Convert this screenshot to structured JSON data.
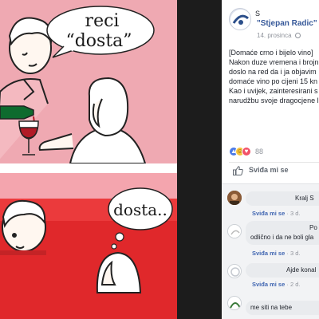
{
  "post": {
    "author_prefix": "S",
    "page_name": "\"Stjepan Radic\" - \"",
    "date": "14. prosinca",
    "body_lines": [
      "[Domaće crno i bijelo vino]",
      "Nakon duze vremena i brojn",
      "doslo na red da i ja objavim",
      "domaće vino po cijeni 15 kn",
      "Kao i uvijek, zainteresirani s",
      "narudžbu svoje dragocjene l"
    ],
    "reaction_count": "88",
    "like_action": "Sviđa mi se"
  },
  "comic": {
    "top_bubble_line1": "reci",
    "top_bubble_line2": "“dosta”",
    "bottom_bubble": "dosta.."
  },
  "comments": [
    {
      "text": "Kralj S",
      "like": "Sviđa mi se",
      "time": "3 d."
    },
    {
      "text_line1": "Po",
      "text_line2": "odlično i da ne boli gla",
      "like": "Sviđa mi se",
      "time": "3 d."
    },
    {
      "text": "Ajde konal",
      "like": "Sviđa mi se",
      "time": "2 d."
    },
    {
      "text": "me siti na tebe"
    }
  ],
  "colors": {
    "comic_pink": "#efa9b2",
    "comic_red": "#eb3a3c",
    "link_blue": "#365899",
    "like_blue": "#4267b2"
  },
  "icons": {
    "like": "thumbs-up-icon",
    "haha": "laughing-face-icon",
    "love": "heart-icon"
  }
}
